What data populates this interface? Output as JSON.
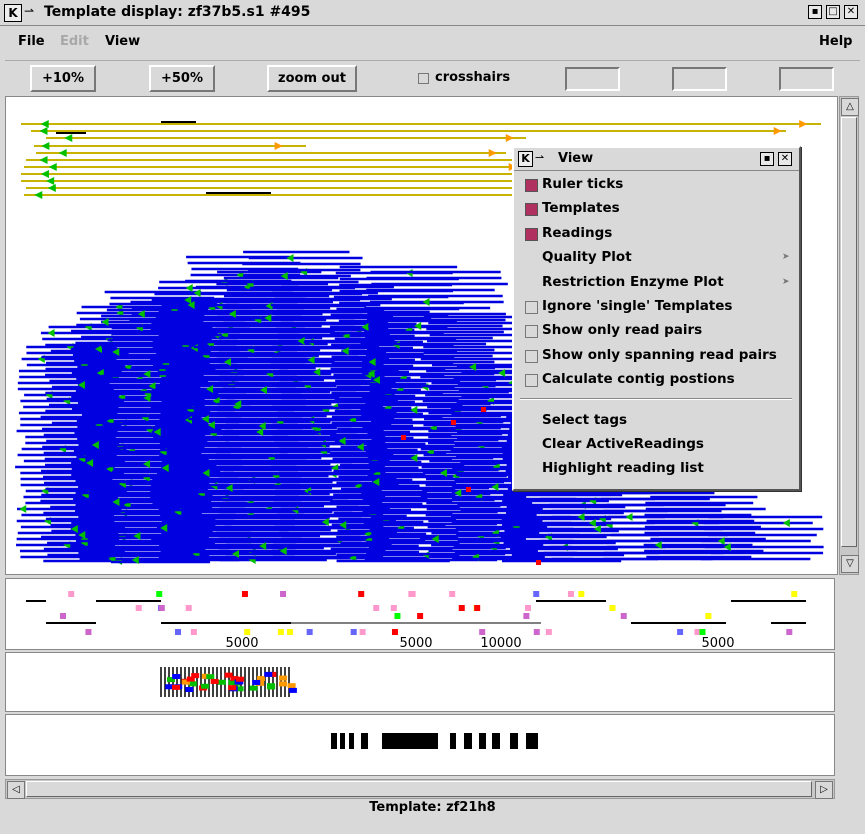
{
  "window": {
    "title": "Template display: zf37b5.s1 #495"
  },
  "menubar": {
    "items": [
      "File",
      "Edit",
      "View"
    ],
    "help": "Help"
  },
  "toolbar": {
    "zoom10": "+10%",
    "zoom50": "+50%",
    "zoomout": "zoom out",
    "crosshairs": "crosshairs"
  },
  "ruler": {
    "ticks": [
      "5000",
      "5000",
      "10000",
      "5000"
    ]
  },
  "status": {
    "text": "Template: zf21h8"
  },
  "view_menu": {
    "title": "View",
    "items": [
      {
        "label": "Ruler ticks",
        "checked": true
      },
      {
        "label": "Templates",
        "checked": true
      },
      {
        "label": "Readings",
        "checked": true
      },
      {
        "label": "Quality Plot",
        "submenu": true
      },
      {
        "label": "Restriction Enzyme Plot",
        "submenu": true
      },
      {
        "label": "Ignore 'single' Templates",
        "checked": false
      },
      {
        "label": "Show only read pairs",
        "checked": false
      },
      {
        "label": "Show only spanning read pairs",
        "checked": false
      },
      {
        "label": "Calculate contig postions",
        "checked": false
      },
      {
        "label": "Select tags"
      },
      {
        "label": "Clear ActiveReadings"
      },
      {
        "label": "Highlight reading list"
      }
    ]
  },
  "colors": {
    "read": "#0000e0",
    "template": "#c8b400",
    "forward_primer": "#00c000",
    "reverse_primer": "#ff9900",
    "check": "#b03060"
  }
}
